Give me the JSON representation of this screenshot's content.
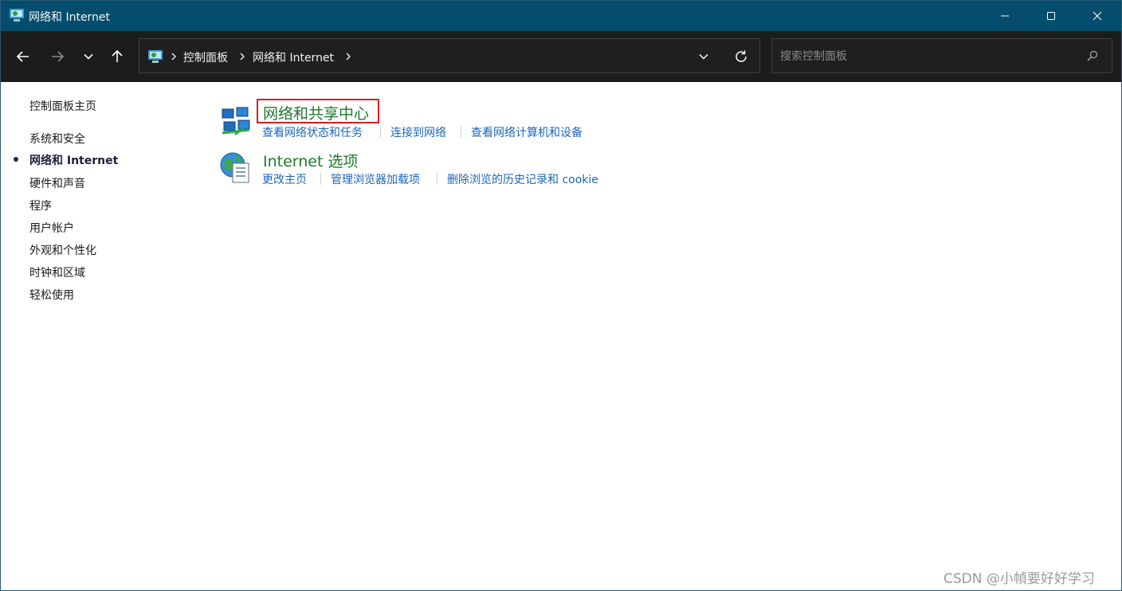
{
  "window": {
    "title": "网络和 Internet",
    "icon": "control-panel-icon"
  },
  "titlebar_buttons": [
    "minimize-icon",
    "maximize-icon",
    "close-icon"
  ],
  "toolbar": {
    "nav_icons": [
      "back-arrow-icon",
      "forward-arrow-icon",
      "chevron-down-icon",
      "up-arrow-icon"
    ],
    "breadcrumb": [
      "控制面板",
      "网络和 Internet"
    ],
    "search_placeholder": "搜索控制面板"
  },
  "sidebar": {
    "home": "控制面板主页",
    "items": [
      {
        "label": "系统和安全",
        "current": false
      },
      {
        "label": "网络和 Internet",
        "current": true
      },
      {
        "label": "硬件和声音",
        "current": false
      },
      {
        "label": "程序",
        "current": false
      },
      {
        "label": "用户帐户",
        "current": false
      },
      {
        "label": "外观和个性化",
        "current": false
      },
      {
        "label": "时钟和区域",
        "current": false
      },
      {
        "label": "轻松使用",
        "current": false
      }
    ]
  },
  "categories": [
    {
      "title": "网络和共享中心",
      "icon": "network-sharing-icon",
      "highlighted": true,
      "links": [
        "查看网络状态和任务",
        "连接到网络",
        "查看网络计算机和设备"
      ]
    },
    {
      "title": "Internet 选项",
      "icon": "internet-options-icon",
      "highlighted": false,
      "links": [
        "更改主页",
        "管理浏览器加载项",
        "删除浏览的历史记录和 cookie"
      ]
    }
  ],
  "colors": {
    "titlebar": "#044d6d",
    "toolbar": "#1c1c1c",
    "category_title": "#1c7a2a",
    "link": "#1b66b8",
    "highlight_border": "#d42020"
  },
  "watermark": "CSDN @小幀要好好学习"
}
